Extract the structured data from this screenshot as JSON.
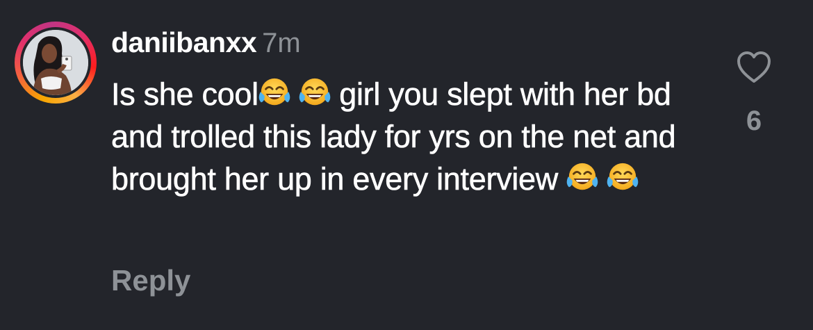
{
  "comment": {
    "username": "daniibanxx",
    "timestamp": "7m",
    "text_parts": {
      "p1": "Is she cool",
      "p2": " girl you slept with her bd and trolled this lady for yrs on the net and brought her up in every interview "
    },
    "emoji_name": "face-with-tears-of-joy",
    "reply_label": "Reply",
    "like_count": "6",
    "like_icon": "heart-outline-icon",
    "avatar_ring_colors": [
      "#f7a500",
      "#e1306c",
      "#c13584"
    ]
  },
  "colors": {
    "background": "#23252b",
    "text_primary": "#ffffff",
    "text_secondary": "#8e9297"
  }
}
